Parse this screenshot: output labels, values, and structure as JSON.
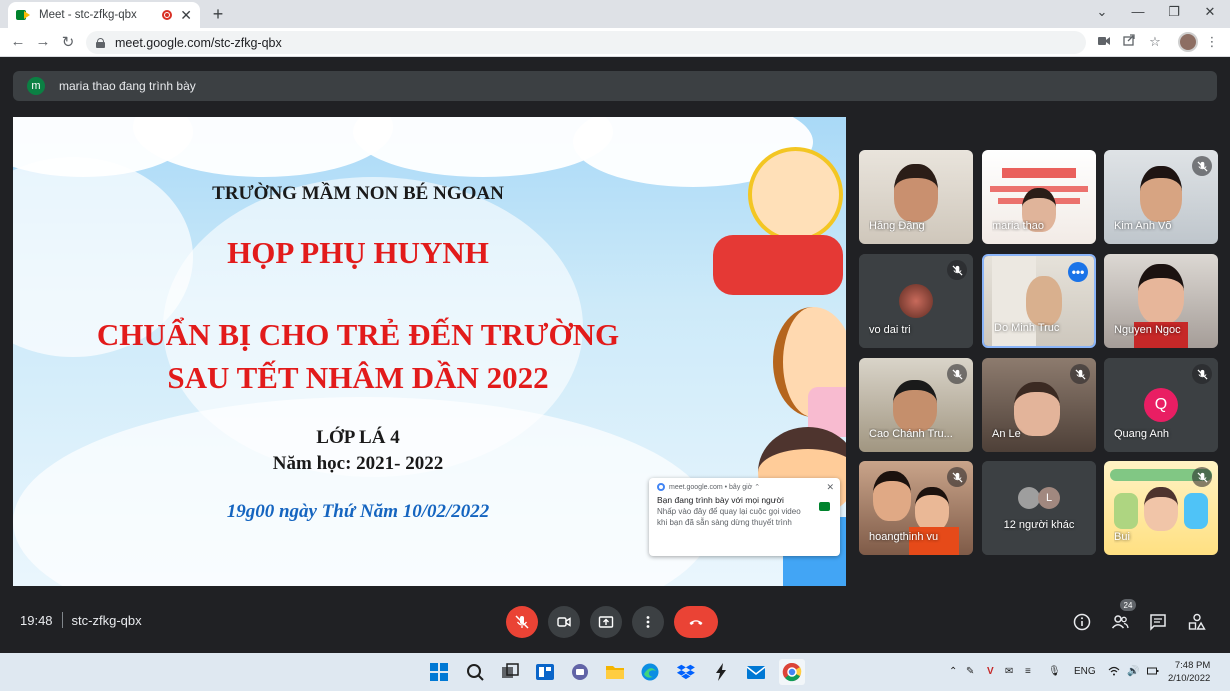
{
  "browser": {
    "tab_title": "Meet - stc-zfkg-qbx",
    "tab_close": "✕",
    "new_tab": "+",
    "url": "meet.google.com/stc-zfkg-qbx",
    "win_dropdown": "⌄",
    "win_min": "—",
    "win_restore": "❐",
    "win_close": "✕"
  },
  "presenter": {
    "avatar_letter": "m",
    "text": "maria thao đang trình bày"
  },
  "slide": {
    "school": "TRƯỜNG MẦM NON BÉ NGOAN",
    "title": "HỌP PHỤ HUYNH",
    "subtitle_1": "CHUẨN BỊ CHO TRẺ ĐẾN TRƯỜNG",
    "subtitle_2": "SAU TẾT NHÂM DẦN 2022",
    "class": "LỚP LÁ 4",
    "school_year": "Năm học: 2021- 2022",
    "datetime": "19g00 ngày Thứ Năm 10/02/2022"
  },
  "notification": {
    "source": "meet.google.com • bây giờ ⌃",
    "title": "Bạn đang trình bày với mọi người",
    "body": "Nhấp vào đây để quay lại cuộc gọi video khi bạn đã sẵn sàng dừng thuyết trình",
    "close": "✕"
  },
  "participants": [
    {
      "name": "Hằng Đặng"
    },
    {
      "name": "maria thao"
    },
    {
      "name": "Kim Anh Võ"
    },
    {
      "name": "vo dai tri"
    },
    {
      "name": "Do Minh Truc"
    },
    {
      "name": "Nguyen Ngoc"
    },
    {
      "name": "Cao Chánh Tru..."
    },
    {
      "name": "An Le"
    },
    {
      "name": "Quang Anh",
      "initial": "Q"
    },
    {
      "name": "hoangthinh vu"
    },
    {
      "name": "12 người khác",
      "initial": "L"
    },
    {
      "name": "Bui"
    }
  ],
  "more_options": "•••",
  "meeting": {
    "time": "19:48",
    "code": "stc-zfkg-qbx",
    "participant_count": "24"
  },
  "taskbar": {
    "lang": "ENG",
    "time": "7:48 PM",
    "date": "2/10/2022"
  },
  "colors": {
    "meet_bg": "#202124",
    "hangup_red": "#ea4335",
    "slide_red": "#e21b1b",
    "slide_blue": "#1565c0",
    "active_border": "#8ab4f8"
  }
}
